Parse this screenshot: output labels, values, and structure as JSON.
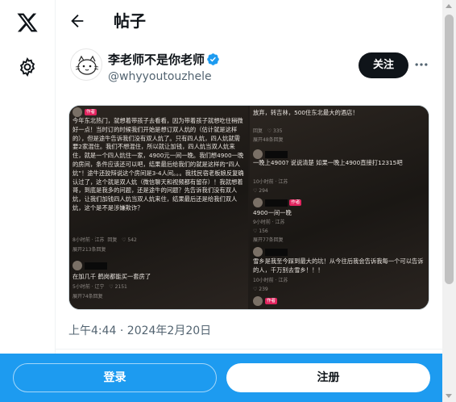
{
  "header": {
    "title": "帖子"
  },
  "author": {
    "name": "李老师不是你老师",
    "handle": "@whyyoutouzhele",
    "follow_label": "关注"
  },
  "post": {
    "timestamp": "上午4:44 · 2024年2月20日"
  },
  "media": {
    "left": {
      "tag": "作者",
      "body": "今年东北热门，就想着带孩子去看看，因为带着孩子就想吃住稍微好一点！当时订的时候我们开始是想订双人炕的（估计就是这样的），但是途牛告诉我们没有双人炕了。只有四人炕，四人炕就需要2家混住。我们不想混住，所以就让加钱，四人炕当双人炕来住，就是一个四人炕住一家，4900元一间一晚。我们想4900一晚的房间，条件应该还可以吧，结果最后给我们的就是这样的“四人炕”！途牛还狡辩说这个房间是3-4人间。。。我找民宿老板娘反复确认过了，这个就是双人炕（微信聊天和视频都有留存）！我就想着哥，到底是我多的问题，还是途牛的问题？先告诉我们没有双人炕，让我们加钱四人炕当双人炕来住，结果最后还是给我们双人炕，这个是不是涉嫌欺诈？",
      "meta1": "8小时前 · 江苏",
      "reply1": "回复",
      "likes1": "542",
      "expand1": "展开213条回复",
      "comment2": "在加几千 鹤岗都能买一套房了",
      "meta2": "5小时前 · 辽宁",
      "likes2": "2151",
      "expand2": "展开74条回复"
    },
    "right": {
      "top": "放弃，转吉林，500住东北最大的酒店！",
      "reply_a": "回复",
      "likes_a": "335",
      "expand_a": "展开48条回复",
      "c1": "一晚上4900? 说说清楚 如果一晚上4900直接打12315吧",
      "meta_c1": "10小时前 · 江苏",
      "likes_c1": "294",
      "tag": "作者",
      "c2": "4900一间一晚",
      "meta_c2": "9小时前 · 江苏",
      "likes_c2": "156",
      "expand_c2": "展开77条回复",
      "c3": "雪乡是我至今踩到最大的坑！从今往后我会告诉我每一个可以告诉的人，千万别去雪乡！！！",
      "meta_c3": "10小时前 · 江苏",
      "likes_c3": "239",
      "tag2": "作者"
    }
  },
  "bottom": {
    "login_label": "登录",
    "signup_label": "注册"
  },
  "colors": {
    "accent": "#1d9bf0",
    "verified": "#1d9bf0",
    "text": "#0f1419",
    "muted": "#536471"
  },
  "icons": [
    "x-logo-icon",
    "gear-icon",
    "back-arrow-icon",
    "verified-badge-icon",
    "more-icon"
  ]
}
